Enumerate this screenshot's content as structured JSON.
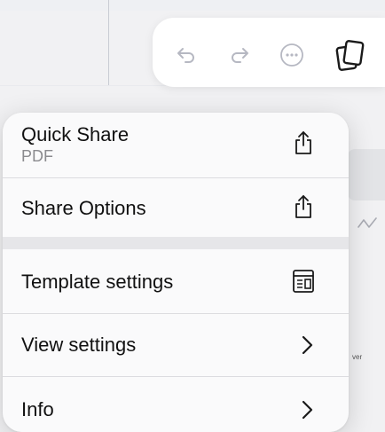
{
  "toolbar": {
    "undo_icon": "undo-icon",
    "redo_icon": "redo-icon",
    "more_icon": "ellipsis-circle-icon",
    "pages_icon": "pages-icon"
  },
  "menu": {
    "quick_share": {
      "label": "Quick Share",
      "sublabel": "PDF",
      "icon": "share-icon"
    },
    "share_options": {
      "label": "Share Options",
      "icon": "share-icon"
    },
    "template_settings": {
      "label": "Template settings",
      "icon": "template-icon"
    },
    "view_settings": {
      "label": "View settings",
      "icon": "chevron-right-icon"
    },
    "info": {
      "label": "Info",
      "icon": "chevron-right-icon"
    }
  },
  "background": {
    "partial_text": "ver"
  },
  "colors": {
    "menu_background": "#fafafb",
    "toolbar_icon": "#b6b8c2",
    "text": "#111111",
    "secondary_text": "#8b8b8f"
  }
}
